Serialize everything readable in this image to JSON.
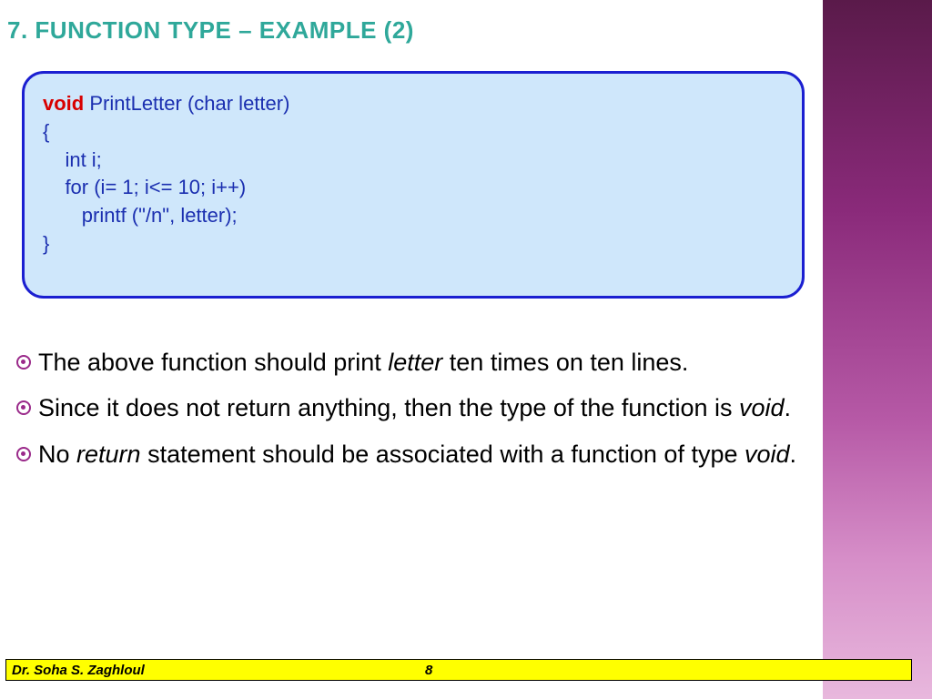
{
  "title": "7. FUNCTION TYPE – EXAMPLE (2)",
  "code": {
    "l1_kw": "void",
    "l1_rest": " PrintLetter (char letter)",
    "l2": "{",
    "l3": "    int i;",
    "l4": "    for (i= 1; i<= 10; i++)",
    "l5": "       printf (\"/n\", letter);",
    "l6": "}"
  },
  "bullets": {
    "b1_a": "The above function should print ",
    "b1_i": "letter",
    "b1_b": " ten times on ten lines.",
    "b2_a": "Since it does not return anything, then the type of the function is ",
    "b2_i": "void",
    "b2_b": ".",
    "b3_a": "No ",
    "b3_i1": "return",
    "b3_b": " statement should be associated with a function of type ",
    "b3_i2": "void",
    "b3_c": "."
  },
  "footer": {
    "author": "Dr. Soha S. Zaghloul",
    "page": "8"
  }
}
